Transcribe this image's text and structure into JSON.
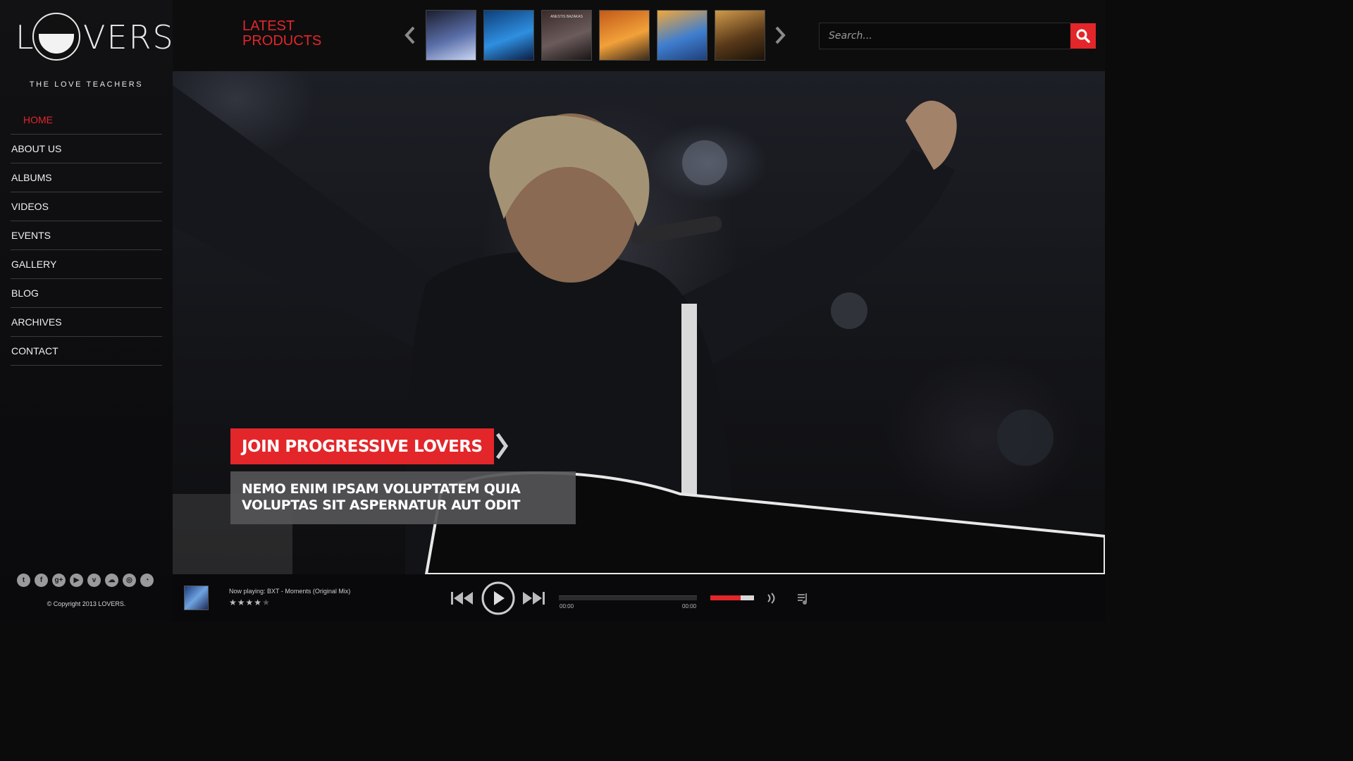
{
  "brand": {
    "logo_left": "L",
    "logo_right": "VERS",
    "tagline": "THE LOVE TEACHERS"
  },
  "nav": {
    "items": [
      {
        "label": "HOME",
        "active": true
      },
      {
        "label": "ABOUT US"
      },
      {
        "label": "ALBUMS"
      },
      {
        "label": "VIDEOS"
      },
      {
        "label": "EVENTS"
      },
      {
        "label": "GALLERY"
      },
      {
        "label": "BLOG"
      },
      {
        "label": "ARCHIVES"
      },
      {
        "label": "CONTACT"
      }
    ]
  },
  "latest": {
    "line1": "LATEST",
    "line2": "PRODUCTS"
  },
  "products": [
    {
      "title": "",
      "colors": [
        "#1b1e2e",
        "#5a6ea8",
        "#c9d6f2"
      ]
    },
    {
      "title": "",
      "colors": [
        "#0d3f7a",
        "#2f8fe0",
        "#0a1e44"
      ]
    },
    {
      "title": "ANESTIS BAZAKAS",
      "colors": [
        "#3b2a2a",
        "#6b5b5b",
        "#1a1515"
      ]
    },
    {
      "title": "",
      "colors": [
        "#c25a1a",
        "#f2a13a",
        "#3a2a1a"
      ]
    },
    {
      "title": "",
      "colors": [
        "#f2a73a",
        "#3f7ecf",
        "#1f3f7a"
      ]
    },
    {
      "title": "",
      "colors": [
        "#d09a4a",
        "#5a3a1a",
        "#1a1208"
      ]
    }
  ],
  "search": {
    "placeholder": "Search..."
  },
  "hero": {
    "caption_title": "JOIN PROGRESSIVE LOVERS",
    "caption_line1": "NEMO ENIM IPSAM VOLUPTATEM QUIA",
    "caption_line2": "VOLUPTAS SIT ASPERNATUR AUT ODIT"
  },
  "social": [
    "twitter-icon",
    "facebook-icon",
    "google-plus-icon",
    "youtube-icon",
    "vimeo-icon",
    "soundcloud-icon",
    "instagram-icon",
    "rss-icon"
  ],
  "footer": {
    "copyright": "© Copyright 2013 LOVERS."
  },
  "player": {
    "now_playing": "Now playing: BXT - Moments (Original Mix)",
    "rating": 4,
    "rating_max": 5,
    "time_current": "00:00",
    "time_total": "00:00",
    "progress": 0,
    "volume": 0.7
  },
  "colors": {
    "accent": "#e3262a",
    "background": "#0b0b0c",
    "caption_box": "#555558"
  }
}
